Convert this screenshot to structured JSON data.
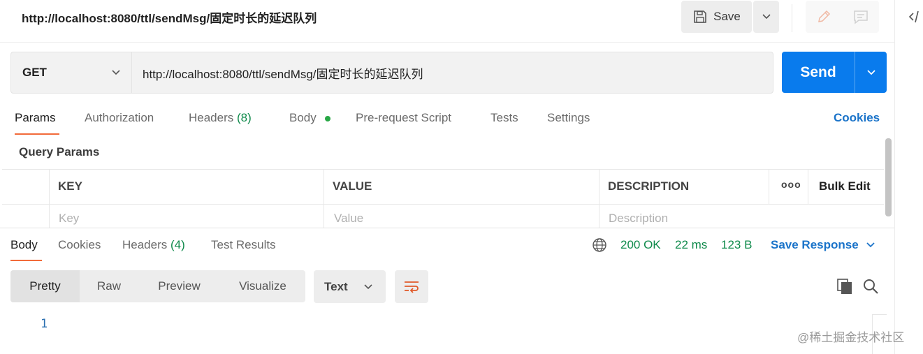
{
  "request": {
    "title": "http://localhost:8080/ttl/sendMsg/固定时长的延迟队列",
    "save_label": "Save",
    "method": "GET",
    "url": "http://localhost:8080/ttl/sendMsg/固定时长的延迟队列",
    "send_label": "Send"
  },
  "request_tabs": {
    "params": "Params",
    "authorization": "Authorization",
    "headers": "Headers",
    "headers_count": "(8)",
    "body": "Body",
    "pre_request": "Pre-request Script",
    "tests": "Tests",
    "settings": "Settings",
    "cookies": "Cookies"
  },
  "params_table": {
    "section_title": "Query Params",
    "columns": [
      "KEY",
      "VALUE",
      "DESCRIPTION"
    ],
    "more": "ooo",
    "bulk_edit": "Bulk Edit",
    "placeholders": [
      "Key",
      "Value",
      "Description"
    ]
  },
  "response": {
    "tabs": {
      "body": "Body",
      "cookies": "Cookies",
      "headers": "Headers",
      "headers_count": "(4)",
      "test_results": "Test Results"
    },
    "status": "200 OK",
    "time": "22 ms",
    "size": "123 B",
    "save_response": "Save Response",
    "views": [
      "Pretty",
      "Raw",
      "Preview",
      "Visualize"
    ],
    "format": "Text",
    "line_numbers": [
      "1"
    ]
  },
  "watermark": "@稀土掘金技术社区",
  "colors": {
    "accent_orange": "#f26b3a",
    "send_blue": "#097bed",
    "link_blue": "#1a73c9",
    "status_green": "#0f8a4b"
  }
}
